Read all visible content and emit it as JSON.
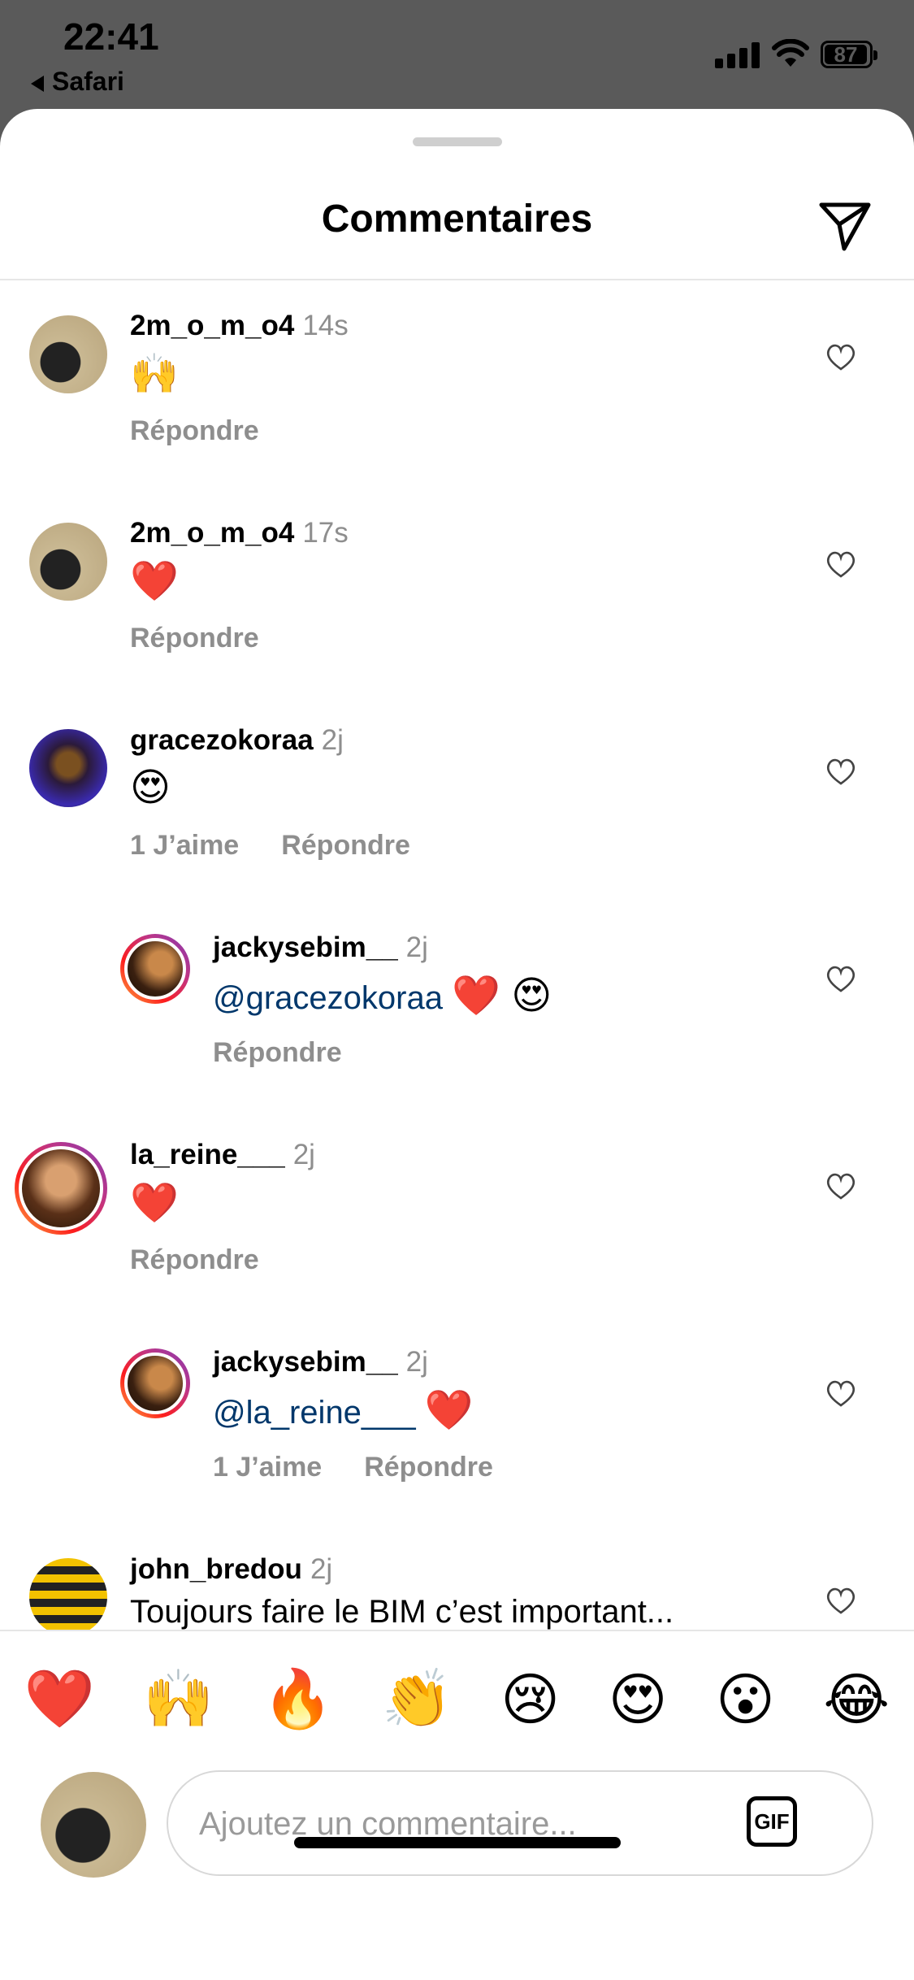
{
  "status_bar": {
    "time": "22:41",
    "back_app": "Safari",
    "battery": "87"
  },
  "header": {
    "title": "Commentaires",
    "share_icon": "paper-plane-icon"
  },
  "comments": [
    {
      "user": "2m_o_m_o4",
      "time": "14s",
      "text": "🙌",
      "likes": "",
      "reply": "Répondre"
    },
    {
      "user": "2m_o_m_o4",
      "time": "17s",
      "text": "❤️",
      "likes": "",
      "reply": "Répondre"
    },
    {
      "user": "gracezokoraa",
      "time": "2j",
      "text": "😍",
      "likes": "1 J’aime",
      "reply": "Répondre"
    },
    {
      "user": "jackysebim__",
      "time": "2j",
      "mention": "@gracezokoraa",
      "text": "❤️ 😍",
      "likes": "",
      "reply": "Répondre"
    },
    {
      "user": "la_reine___",
      "time": "2j",
      "text": "❤️",
      "likes": "",
      "reply": "Répondre"
    },
    {
      "user": "jackysebim__",
      "time": "2j",
      "mention": "@la_reine___",
      "text": "❤️",
      "likes": "1 J’aime",
      "reply": "Répondre"
    },
    {
      "user": "john_bredou",
      "time": "2j",
      "text": "Toujours faire le BIM c’est important..."
    }
  ],
  "reactions": [
    "❤️",
    "🙌",
    "🔥",
    "👏",
    "😢",
    "😍",
    "😮",
    "😂"
  ],
  "composer": {
    "placeholder": "Ajoutez un commentaire...",
    "gif_label": "GIF"
  },
  "colors": {
    "mention": "#00376b",
    "secondary": "#8e8e8e",
    "status_bar_bg": "#5a5a5a"
  }
}
